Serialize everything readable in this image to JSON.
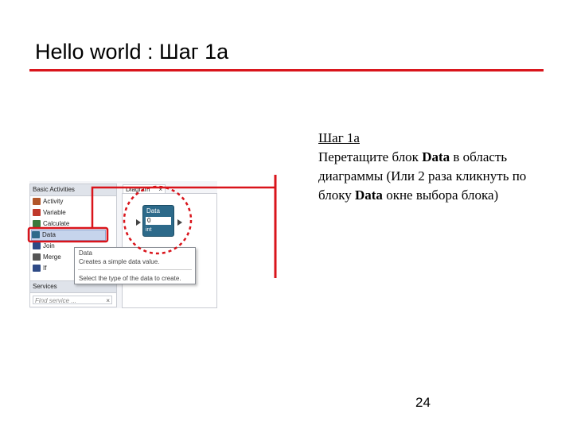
{
  "slide": {
    "title": "Hello world : Шаг 1а",
    "step_label": "Шаг 1а",
    "instruction_1": "Перетащите блок ",
    "instruction_bold_1": "Data",
    "instruction_2": " в область диаграммы (Или 2 раза кликнуть по блоку ",
    "instruction_bold_2": "Data",
    "instruction_3": " окне выбора блока)",
    "page_number": "24"
  },
  "screenshot": {
    "toolbox_title": "Basic Activities",
    "toolbox_items": [
      {
        "label": "Activity",
        "icon": "activity-icon",
        "color": "#b2562a"
      },
      {
        "label": "Variable",
        "icon": "variable-icon",
        "color": "#c0392b"
      },
      {
        "label": "Calculate",
        "icon": "calculate-icon",
        "color": "#3b7a3b"
      },
      {
        "label": "Data",
        "icon": "data-icon",
        "color": "#2d6a8a"
      },
      {
        "label": "Join",
        "icon": "join-icon",
        "color": "#2e4a86"
      },
      {
        "label": "Merge",
        "icon": "merge-icon",
        "color": "#555555"
      },
      {
        "label": "If",
        "icon": "if-icon",
        "color": "#2e4a86"
      }
    ],
    "services_title": "Services",
    "find_placeholder": "Find service ...",
    "close_glyph": "×",
    "diagram_tab": "Diagram",
    "block_title": "Data",
    "block_value": "0",
    "block_type": "int",
    "tooltip_title": "Data",
    "tooltip_desc": "Creates a simple data value.",
    "tooltip_hint": "Select the type of the data to create."
  },
  "colors": {
    "accent_red": "#d9141b",
    "block_blue": "#2d6a8a"
  }
}
